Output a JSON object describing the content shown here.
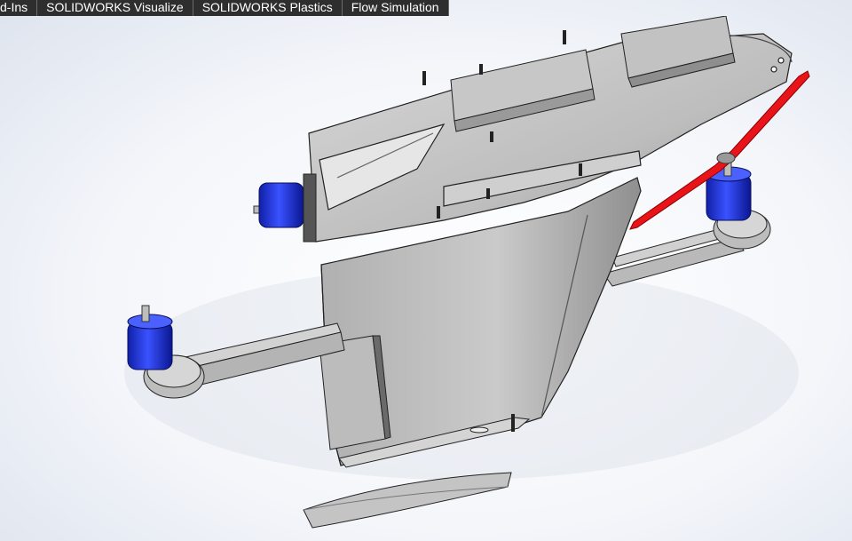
{
  "tabs": [
    {
      "label": "d-Ins"
    },
    {
      "label": "SOLIDWORKS Visualize"
    },
    {
      "label": "SOLIDWORKS Plastics"
    },
    {
      "label": "Flow Simulation"
    }
  ],
  "colors": {
    "toolbar_bg": "#2e2e2e",
    "model_gray": "#c6c6c6",
    "motor_blue": "#1a2fd6",
    "propeller_red": "#e8141a"
  }
}
